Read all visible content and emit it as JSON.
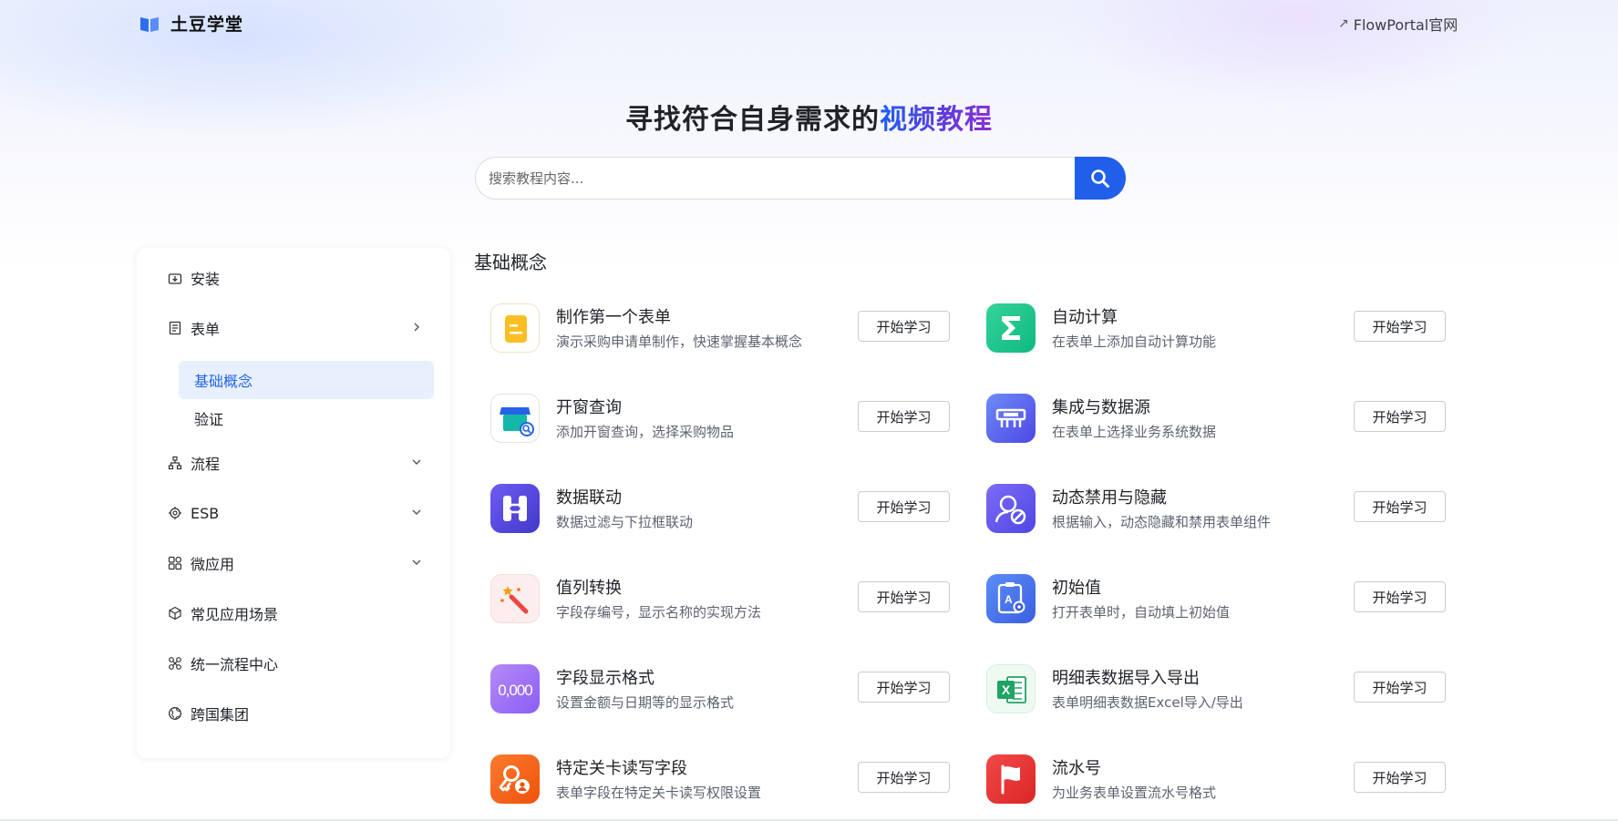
{
  "header": {
    "brand": "土豆学堂",
    "external_link": "FlowPortal官网"
  },
  "hero": {
    "title_part1": "寻找符合自身需求的",
    "title_highlight": "视频教程",
    "search_placeholder": "搜索教程内容..."
  },
  "colors": {
    "accent": "#1f5fea",
    "active_bg": "#e8f0fe",
    "active_text": "#2465e8"
  },
  "sidebar": {
    "items": [
      {
        "label": "安装",
        "icon": "download-box-icon"
      },
      {
        "label": "表单",
        "icon": "form-icon",
        "expanded": true,
        "children": [
          {
            "label": "基础概念",
            "active": true
          },
          {
            "label": "验证",
            "active": false
          }
        ]
      },
      {
        "label": "流程",
        "icon": "flowchart-icon"
      },
      {
        "label": "ESB",
        "icon": "chip-icon"
      },
      {
        "label": "微应用",
        "icon": "grid-apps-icon"
      },
      {
        "label": "常见应用场景",
        "icon": "cube-icon"
      },
      {
        "label": "统一流程中心",
        "icon": "hub-icon"
      },
      {
        "label": "跨国集团",
        "icon": "globe-icon"
      }
    ]
  },
  "content": {
    "section_title": "基础概念",
    "button_label": "开始学习",
    "cards": [
      {
        "title": "制作第一个表单",
        "desc": "演示采购申请单制作，快速掌握基本概念",
        "icon": "document-icon"
      },
      {
        "title": "自动计算",
        "desc": "在表单上添加自动计算功能",
        "icon": "sigma-icon"
      },
      {
        "title": "开窗查询",
        "desc": "添加开窗查询，选择采购物品",
        "icon": "store-search-icon"
      },
      {
        "title": "集成与数据源",
        "desc": "在表单上选择业务系统数据",
        "icon": "connector-icon"
      },
      {
        "title": "数据联动",
        "desc": "数据过滤与下拉框联动",
        "icon": "link-icon"
      },
      {
        "title": "动态禁用与隐藏",
        "desc": "根据输入，动态隐藏和禁用表单组件",
        "icon": "disable-icon"
      },
      {
        "title": "值列转换",
        "desc": "字段存编号，显示名称的实现方法",
        "icon": "magic-wand-icon"
      },
      {
        "title": "初始值",
        "desc": "打开表单时，自动填上初始值",
        "icon": "initial-value-icon"
      },
      {
        "title": "字段显示格式",
        "desc": "设置金额与日期等的显示格式",
        "icon": "number-format-icon"
      },
      {
        "title": "明细表数据导入导出",
        "desc": "表单明细表数据Excel导入/导出",
        "icon": "excel-icon"
      },
      {
        "title": "特定关卡读写字段",
        "desc": "表单字段在特定关卡读写权限设置",
        "icon": "key-user-icon"
      },
      {
        "title": "流水号",
        "desc": "为业务表单设置流水号格式",
        "icon": "flag-icon"
      }
    ]
  }
}
